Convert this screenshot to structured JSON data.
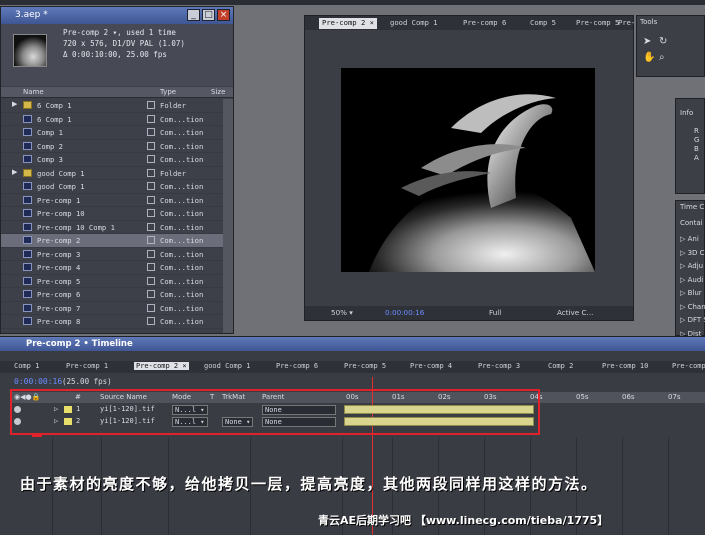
{
  "project": {
    "title": "3.aep *",
    "selected_comp_line": "Pre-comp 2 ▾, used 1 time",
    "dims_line": "720 x 576, D1/DV PAL (1.07)",
    "duration_line": "Δ 0:00:10:00, 25.00 fps",
    "columns": {
      "name": "Name",
      "type": "Type",
      "size": "Size"
    },
    "items": [
      {
        "name": "6 Comp 1",
        "type": "Folder",
        "kind": "folder"
      },
      {
        "name": "6 Comp 1",
        "type": "Com...tion",
        "kind": "comp"
      },
      {
        "name": "Comp 1",
        "type": "Com...tion",
        "kind": "comp"
      },
      {
        "name": "Comp 2",
        "type": "Com...tion",
        "kind": "comp"
      },
      {
        "name": "Comp 3",
        "type": "Com...tion",
        "kind": "comp"
      },
      {
        "name": "good Comp 1",
        "type": "Folder",
        "kind": "folder"
      },
      {
        "name": "good Comp 1",
        "type": "Com...tion",
        "kind": "comp"
      },
      {
        "name": "Pre-comp 1",
        "type": "Com...tion",
        "kind": "comp"
      },
      {
        "name": "Pre-comp 10",
        "type": "Com...tion",
        "kind": "comp"
      },
      {
        "name": "Pre-comp 10 Comp 1",
        "type": "Com...tion",
        "kind": "comp"
      },
      {
        "name": "Pre-comp 2",
        "type": "Com...tion",
        "kind": "comp",
        "selected": true
      },
      {
        "name": "Pre-comp 3",
        "type": "Com...tion",
        "kind": "comp"
      },
      {
        "name": "Pre-comp 4",
        "type": "Com...tion",
        "kind": "comp"
      },
      {
        "name": "Pre-comp 5",
        "type": "Com...tion",
        "kind": "comp"
      },
      {
        "name": "Pre-comp 6",
        "type": "Com...tion",
        "kind": "comp"
      },
      {
        "name": "Pre-comp 7",
        "type": "Com...tion",
        "kind": "comp"
      },
      {
        "name": "Pre-comp 8",
        "type": "Com...tion",
        "kind": "comp"
      }
    ]
  },
  "viewer": {
    "tabs": [
      "Pre-comp 2 ×",
      "good Comp 1",
      "Pre-comp 6",
      "Comp 5",
      "Pre-comp 5",
      "Pre-"
    ],
    "zoom": "50% ▾",
    "timecode": "0:00:00:16",
    "resolution": "Full",
    "camera": "Active C..."
  },
  "tools": {
    "title": "Tools"
  },
  "info": {
    "title": "Info",
    "channels": [
      "R",
      "G",
      "B",
      "A"
    ]
  },
  "time_controls": {
    "title": "Time C",
    "contents_label": "Contai",
    "effects": [
      "▷ Ani",
      "▷ 3D Ch",
      "▷ Adju",
      "▷ Audi",
      "▷ Blur",
      "▷ Chann",
      "▷ DFT S",
      "▷ Dist"
    ]
  },
  "timeline": {
    "title": "Pre-comp 2 • Timeline",
    "tabs": [
      "Comp 1",
      "Pre-comp 1",
      "Pre-comp 2 ×",
      "good Comp 1",
      "Pre-comp 6",
      "Pre-comp 5",
      "Pre-comp 4",
      "Pre-comp 3",
      "Comp 2",
      "Pre-comp 10",
      "Pre-comp"
    ],
    "current_time": "0:00:00:16",
    "fps": "(25.00 fps)",
    "columns": {
      "num": "#",
      "source": "Source Name",
      "mode": "Mode",
      "t": "T",
      "trkmat": "TrkMat",
      "parent": "Parent"
    },
    "ruler": [
      "00s",
      "01s",
      "02s",
      "03s",
      "04s",
      "05s",
      "06s",
      "07s"
    ],
    "layers": [
      {
        "num": "1",
        "source": "yi[1-120].tif",
        "mode": "N...l ▾",
        "trkmat": "",
        "parent": "None"
      },
      {
        "num": "2",
        "source": "yi[1-120].tif",
        "mode": "N...l ▾",
        "trkmat": "None ▾",
        "parent": "None"
      }
    ]
  },
  "caption": "由于素材的亮度不够，给他拷贝一层，提高亮度，其他两段同样用这样的方法。",
  "watermark": "青云AE后期学习吧  【www.linecg.com/tieba/1775】"
}
